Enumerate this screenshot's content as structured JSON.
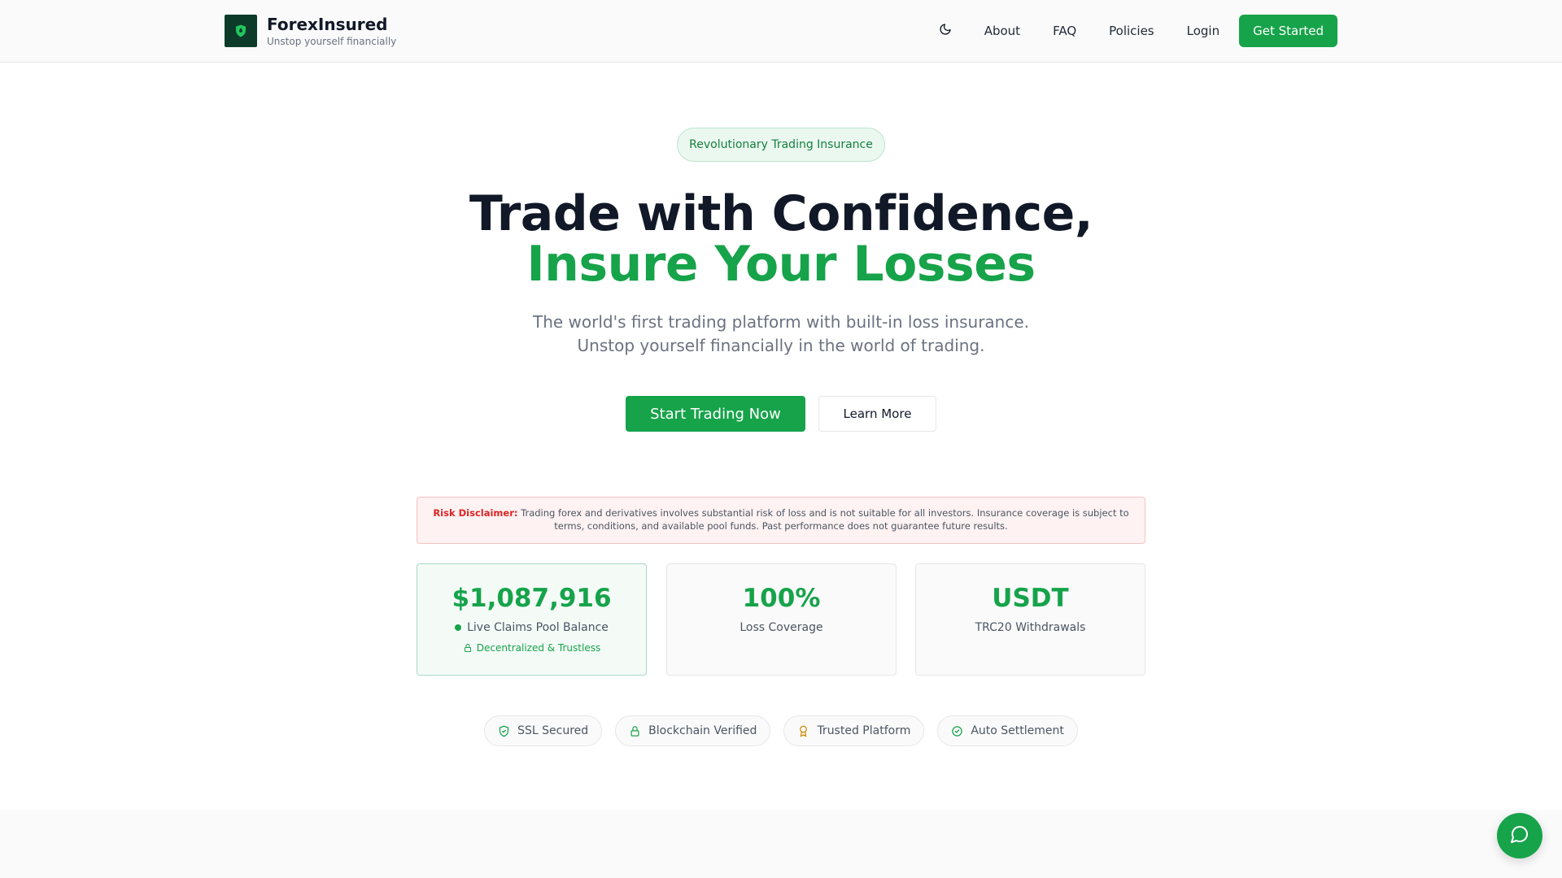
{
  "brand": {
    "name": "ForexInsured",
    "tagline": "Unstop yourself financially",
    "logo_icon": "shield-icon",
    "colors": {
      "primary": "#16a34a",
      "logo_bg": "#0c3b2a",
      "danger": "#dc2626"
    }
  },
  "nav": {
    "theme_icon": "moon-icon",
    "items": [
      "About",
      "FAQ",
      "Policies",
      "Login"
    ],
    "cta": "Get Started"
  },
  "hero": {
    "badge": "Revolutionary Trading Insurance",
    "title_line1": "Trade with Confidence,",
    "title_line2": "Insure Your Losses",
    "subtitle": "The world's first trading platform with built-in loss insurance. Unstop yourself financially in the world of trading.",
    "primary_cta": "Start Trading Now",
    "secondary_cta": "Learn More"
  },
  "disclaimer": {
    "label": "Risk Disclaimer:",
    "text": "Trading forex and derivatives involves substantial risk of loss and is not suitable for all investors. Insurance coverage is subject to terms, conditions, and available pool funds. Past performance does not guarantee future results."
  },
  "stats": [
    {
      "value": "$1,087,916",
      "label": "Live Claims Pool Balance",
      "sub": "Decentralized & Trustless",
      "sub_icon": "lock-icon"
    },
    {
      "value": "100%",
      "label": "Loss Coverage"
    },
    {
      "value": "USDT",
      "label": "TRC20 Withdrawals"
    }
  ],
  "trust": [
    {
      "label": "SSL Secured",
      "icon": "shield-check-icon"
    },
    {
      "label": "Blockchain Verified",
      "icon": "lock-icon"
    },
    {
      "label": "Trusted Platform",
      "icon": "award-icon"
    },
    {
      "label": "Auto Settlement",
      "icon": "check-circle-icon"
    }
  ],
  "chat": {
    "icon": "chat-bubble-icon"
  }
}
